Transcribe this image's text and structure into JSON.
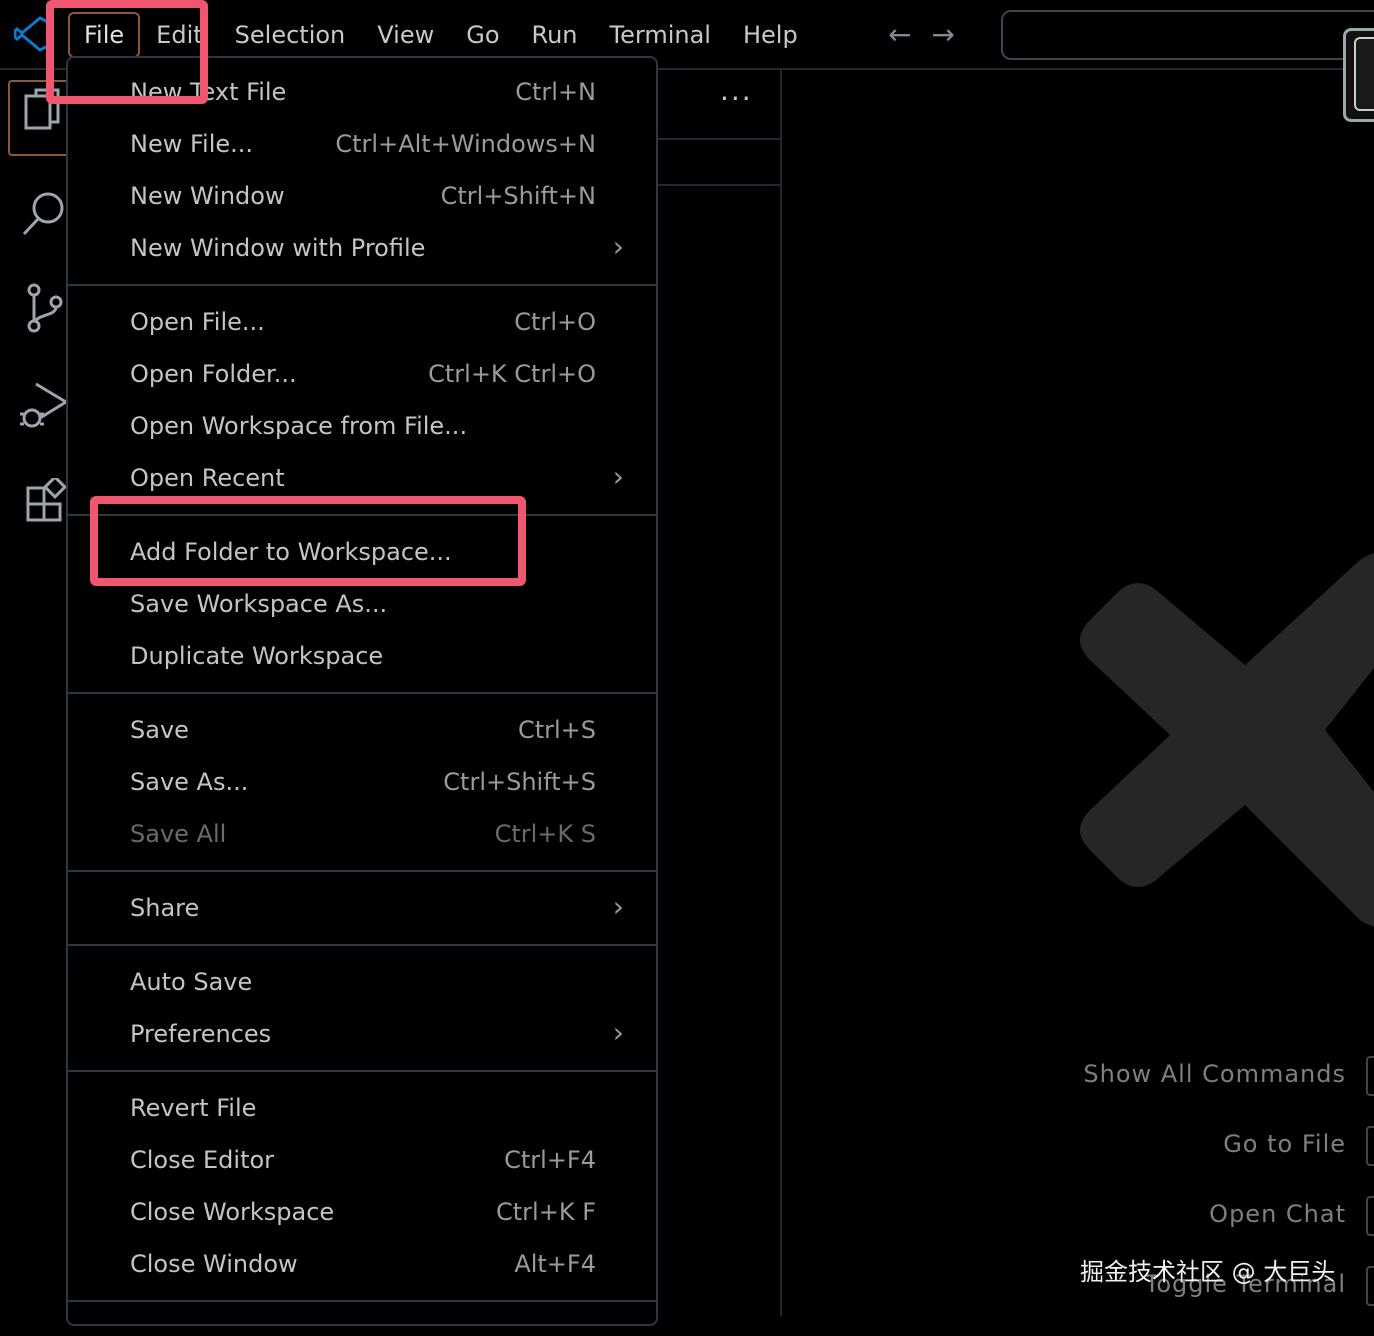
{
  "menubar": {
    "items": [
      "File",
      "Edit",
      "Selection",
      "View",
      "Go",
      "Run",
      "Terminal",
      "Help"
    ],
    "nav_back": "←",
    "nav_forward": "→"
  },
  "sidebar": {
    "more_actions": "···"
  },
  "file_menu": {
    "items": [
      {
        "label": "New Text File",
        "key": "Ctrl+N"
      },
      {
        "label": "New File...",
        "key": "Ctrl+Alt+Windows+N"
      },
      {
        "label": "New Window",
        "key": "Ctrl+Shift+N"
      },
      {
        "label": "New Window with Profile",
        "key": ""
      },
      {
        "label": "Open File...",
        "key": "Ctrl+O"
      },
      {
        "label": "Open Folder...",
        "key": "Ctrl+K Ctrl+O"
      },
      {
        "label": "Open Workspace from File...",
        "key": ""
      },
      {
        "label": "Open Recent",
        "key": ""
      },
      {
        "label": "Add Folder to Workspace...",
        "key": ""
      },
      {
        "label": "Save Workspace As...",
        "key": ""
      },
      {
        "label": "Duplicate Workspace",
        "key": ""
      },
      {
        "label": "Save",
        "key": "Ctrl+S"
      },
      {
        "label": "Save As...",
        "key": "Ctrl+Shift+S"
      },
      {
        "label": "Save All",
        "key": "Ctrl+K S"
      },
      {
        "label": "Share",
        "key": ""
      },
      {
        "label": "Auto Save",
        "key": ""
      },
      {
        "label": "Preferences",
        "key": ""
      },
      {
        "label": "Revert File",
        "key": ""
      },
      {
        "label": "Close Editor",
        "key": "Ctrl+F4"
      },
      {
        "label": "Close Workspace",
        "key": "Ctrl+K F"
      },
      {
        "label": "Close Window",
        "key": "Alt+F4"
      }
    ],
    "submenu_chevron": "›"
  },
  "editor_shortcuts": [
    "Show All Commands",
    "Go to File",
    "Open Chat",
    "Toggle Terminal"
  ],
  "credit": "掘金技术社区 @ 大巨头",
  "colors": {
    "highlight": "#f0566f",
    "background": "#000000",
    "border": "#2a3744"
  }
}
